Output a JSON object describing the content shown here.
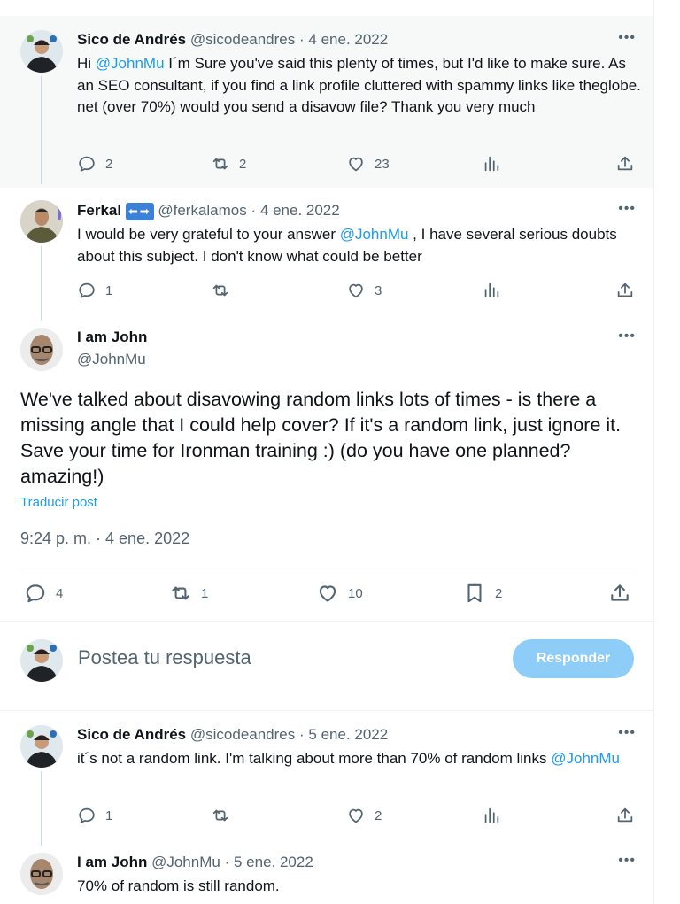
{
  "tweets": [
    {
      "name": "Sico de Andrés",
      "handle": "@sicodeandres",
      "sep": "·",
      "date": "4 ene. 2022",
      "body_pre": "Hi ",
      "mention": "@JohnMu",
      "body_post": "  I´m Sure you've said this plenty of times, but I'd like to make sure. As an SEO consultant, if you find a link profile cluttered with spammy links like theglobe. net (over 70%) would you send a disavow file? Thank you very much",
      "replies": "2",
      "reposts": "2",
      "likes": "23"
    },
    {
      "name": "Ferkal",
      "badge": "⬅➡",
      "handle": "@ferkalamos",
      "sep": "·",
      "date": "4 ene. 2022",
      "body_pre": "I would be very grateful to your answer ",
      "mention": "@JohnMu",
      "body_post": " , I have several serious doubts about this subject. I don't know what could be better",
      "replies": "1",
      "reposts": "",
      "likes": "3"
    }
  ],
  "main": {
    "name": "I am John",
    "handle": "@JohnMu",
    "body": "We've talked about disavowing random links lots of times - is there a missing angle that I could help cover? If it's a random link, just ignore it. Save your time for Ironman training :) (do you have one planned? amazing!)",
    "translate": "Traducir post",
    "timestamp": "9:24 p. m. · 4 ene. 2022",
    "replies": "4",
    "reposts": "1",
    "likes": "10",
    "bookmarks": "2"
  },
  "reply_box": {
    "placeholder": "Postea tu respuesta",
    "button": "Responder"
  },
  "replies": [
    {
      "name": "Sico de Andrés",
      "handle": "@sicodeandres",
      "sep": "·",
      "date": "5 ene. 2022",
      "body_pre": "it´s not a random link. I'm talking about more than 70% of random links ",
      "mention": "@JohnMu",
      "body_post": "",
      "replies": "1",
      "reposts": "",
      "likes": "2"
    },
    {
      "name": "I am John",
      "handle": "@JohnMu",
      "sep": "·",
      "date": "5 ene. 2022",
      "body_pre": "70% of random is still random.",
      "mention": "",
      "body_post": ""
    }
  ],
  "more_glyph": "•••",
  "colors": {
    "accent": "#1d9bf0",
    "muted": "#536471",
    "button_disabled": "#8ecdf8"
  }
}
